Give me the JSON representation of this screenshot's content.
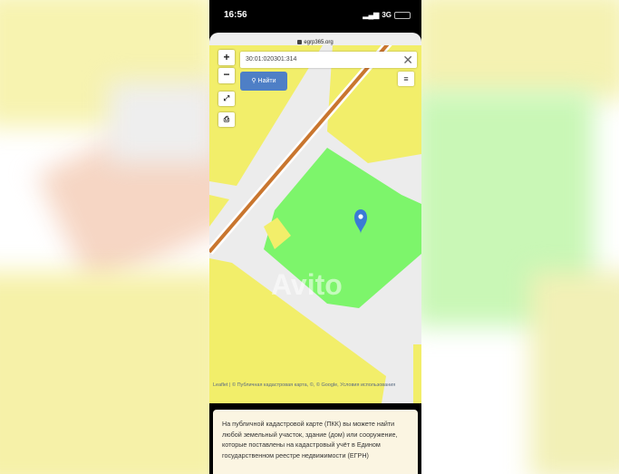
{
  "status_bar": {
    "time": "16:56",
    "network": "3G"
  },
  "browser": {
    "url": "egrp365.org"
  },
  "map": {
    "search_value": "30:01:020301:314",
    "find_button_label": "Найти",
    "zoom_in_label": "+",
    "zoom_out_label": "−",
    "attribution": "Leaflet | © Публичная кадастровая карта, ©, © Google, Условия использования",
    "watermark": "Avito"
  },
  "info": {
    "text": "На публичной кадастровой карте (ПКК) вы можете найти любой земельный участок, здание (дом) или сооружение, которые поставлены на кадастровый учёт в Едином государственном реестре недвижимости (ЕГРН)"
  },
  "colors": {
    "parcel_yellow": "#f2ee6a",
    "highlight_green": "#7df56b",
    "road": "#c9762f",
    "button_blue": "#4e7fc6",
    "marker": "#3a7bd5"
  },
  "icons": [
    "lock-icon",
    "close-icon",
    "search-icon",
    "menu-icon",
    "fullscreen-icon",
    "print-icon",
    "map-marker-icon",
    "battery-icon",
    "signal-icon"
  ]
}
